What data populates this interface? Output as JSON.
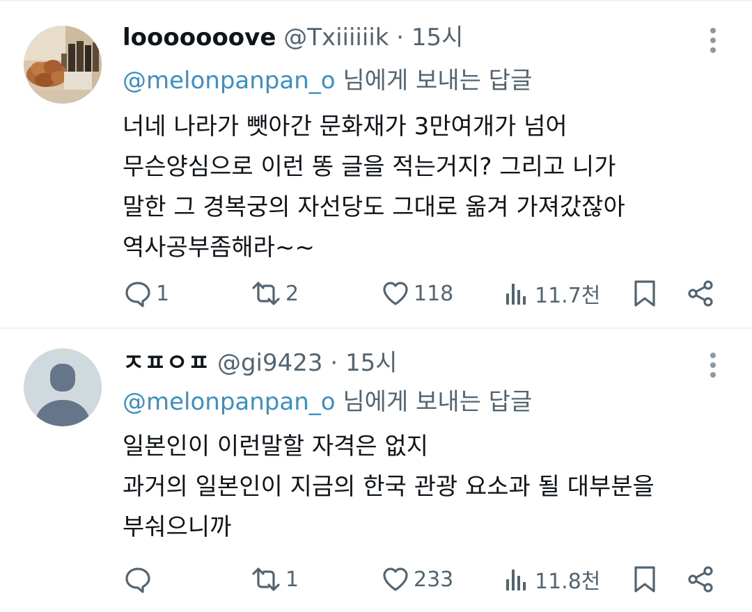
{
  "tweets": [
    {
      "display_name": "looooooove",
      "handle": "@Txiiiiiik",
      "separator": "·",
      "time": "15시",
      "reply_mention": "@melonpanpan_o",
      "reply_suffix": "님에게 보내는 답글",
      "body_lines": [
        "너네 나라가 뺏아간 문화재가 3만여개가 넘어",
        "무슨양심으로 이런 똥 글을 적는거지? 그리고 니가",
        "말한 그 경복궁의 자선당도 그대로 옮겨 가져갔잖아",
        "역사공부좀해라~~"
      ],
      "actions": {
        "reply_count": "1",
        "retweet_count": "2",
        "like_count": "118",
        "view_count": "11.7천"
      },
      "avatar_icon": "profile-photo"
    },
    {
      "display_name": "ㅈㅍㅇㅍ",
      "handle": "@gi9423",
      "separator": "·",
      "time": "15시",
      "reply_mention": "@melonpanpan_o",
      "reply_suffix": "님에게 보내는 답글",
      "body_lines": [
        "일본인이 이런말할 자격은 없지",
        "과거의 일본인이 지금의 한국 관광 요소과 될 대부분을",
        "부숴으니까"
      ],
      "actions": {
        "reply_count": "",
        "retweet_count": "1",
        "like_count": "233",
        "view_count": "11.8천"
      },
      "avatar_icon": "default-avatar-icon"
    }
  ],
  "colors": {
    "text": "#0f1419",
    "secondary": "#536471",
    "mention": "#3b8fc4",
    "divider": "#eff3f4"
  }
}
